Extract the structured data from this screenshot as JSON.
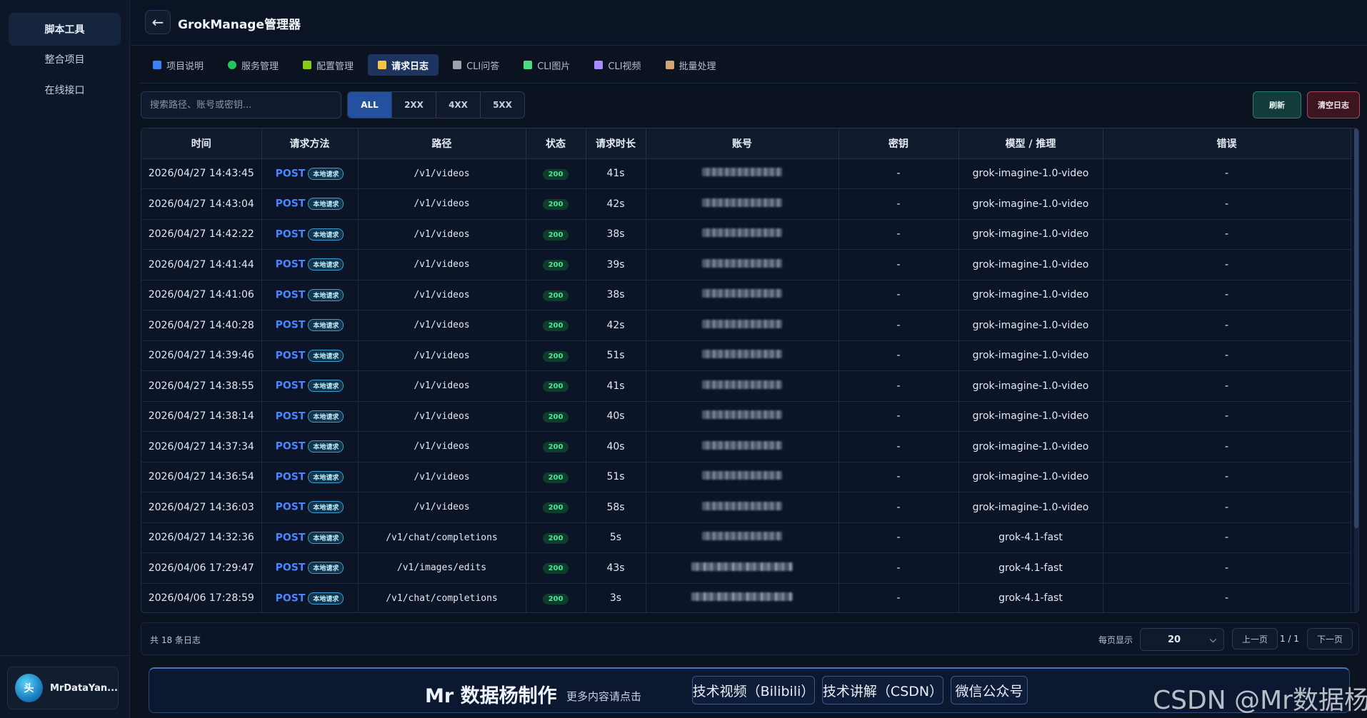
{
  "sidebar": {
    "items": [
      {
        "label": "脚本工具",
        "active": true
      },
      {
        "label": "整合项目",
        "active": false
      },
      {
        "label": "在线接口",
        "active": false
      }
    ],
    "user": {
      "avatar_text": "头",
      "name": "MrDataYan..."
    }
  },
  "header": {
    "back_icon": "arrow-left-icon",
    "back_glyph": "←",
    "title": "GrokManage管理器"
  },
  "tabs": [
    {
      "label": "项目说明",
      "icon": "book-icon",
      "color": "#3b82f6",
      "active": false
    },
    {
      "label": "服务管理",
      "icon": "circle-icon",
      "color": "#22c55e",
      "active": false
    },
    {
      "label": "配置管理",
      "icon": "gear-icon",
      "color": "#84cc16",
      "active": false
    },
    {
      "label": "请求日志",
      "icon": "scroll-icon",
      "color": "#f5c542",
      "active": true
    },
    {
      "label": "CLI问答",
      "icon": "chat-bubble-icon",
      "color": "#9ca3af",
      "active": false
    },
    {
      "label": "CLI图片",
      "icon": "image-icon",
      "color": "#4ade80",
      "active": false
    },
    {
      "label": "CLI视频",
      "icon": "film-icon",
      "color": "#a78bfa",
      "active": false
    },
    {
      "label": "批量处理",
      "icon": "package-icon",
      "color": "#d4a373",
      "active": false
    }
  ],
  "filter": {
    "search_placeholder": "搜索路径、账号或密钥...",
    "status_options": [
      {
        "label": "ALL",
        "active": true
      },
      {
        "label": "2XX",
        "active": false
      },
      {
        "label": "4XX",
        "active": false
      },
      {
        "label": "5XX",
        "active": false
      }
    ],
    "refresh_label": "刷新",
    "clear_label": "清空日志"
  },
  "table": {
    "columns": [
      "时间",
      "请求方法",
      "路径",
      "状态",
      "请求时长",
      "账号",
      "密钥",
      "模型 / 推理",
      "错误"
    ],
    "local_badge": "本地请求",
    "rows": [
      {
        "time": "2026/04/27 14:43:45",
        "method": "POST",
        "path": "/v1/videos",
        "status": "200",
        "duration": "41s",
        "key": "-",
        "model": "grok-imagine-1.0-video",
        "error": "-"
      },
      {
        "time": "2026/04/27 14:43:04",
        "method": "POST",
        "path": "/v1/videos",
        "status": "200",
        "duration": "42s",
        "key": "-",
        "model": "grok-imagine-1.0-video",
        "error": "-"
      },
      {
        "time": "2026/04/27 14:42:22",
        "method": "POST",
        "path": "/v1/videos",
        "status": "200",
        "duration": "38s",
        "key": "-",
        "model": "grok-imagine-1.0-video",
        "error": "-"
      },
      {
        "time": "2026/04/27 14:41:44",
        "method": "POST",
        "path": "/v1/videos",
        "status": "200",
        "duration": "39s",
        "key": "-",
        "model": "grok-imagine-1.0-video",
        "error": "-"
      },
      {
        "time": "2026/04/27 14:41:06",
        "method": "POST",
        "path": "/v1/videos",
        "status": "200",
        "duration": "38s",
        "key": "-",
        "model": "grok-imagine-1.0-video",
        "error": "-"
      },
      {
        "time": "2026/04/27 14:40:28",
        "method": "POST",
        "path": "/v1/videos",
        "status": "200",
        "duration": "42s",
        "key": "-",
        "model": "grok-imagine-1.0-video",
        "error": "-"
      },
      {
        "time": "2026/04/27 14:39:46",
        "method": "POST",
        "path": "/v1/videos",
        "status": "200",
        "duration": "51s",
        "key": "-",
        "model": "grok-imagine-1.0-video",
        "error": "-"
      },
      {
        "time": "2026/04/27 14:38:55",
        "method": "POST",
        "path": "/v1/videos",
        "status": "200",
        "duration": "41s",
        "key": "-",
        "model": "grok-imagine-1.0-video",
        "error": "-"
      },
      {
        "time": "2026/04/27 14:38:14",
        "method": "POST",
        "path": "/v1/videos",
        "status": "200",
        "duration": "40s",
        "key": "-",
        "model": "grok-imagine-1.0-video",
        "error": "-"
      },
      {
        "time": "2026/04/27 14:37:34",
        "method": "POST",
        "path": "/v1/videos",
        "status": "200",
        "duration": "40s",
        "key": "-",
        "model": "grok-imagine-1.0-video",
        "error": "-"
      },
      {
        "time": "2026/04/27 14:36:54",
        "method": "POST",
        "path": "/v1/videos",
        "status": "200",
        "duration": "51s",
        "key": "-",
        "model": "grok-imagine-1.0-video",
        "error": "-"
      },
      {
        "time": "2026/04/27 14:36:03",
        "method": "POST",
        "path": "/v1/videos",
        "status": "200",
        "duration": "58s",
        "key": "-",
        "model": "grok-imagine-1.0-video",
        "error": "-"
      },
      {
        "time": "2026/04/27 14:32:36",
        "method": "POST",
        "path": "/v1/chat/completions",
        "status": "200",
        "duration": "5s",
        "key": "-",
        "model": "grok-4.1-fast",
        "error": "-"
      },
      {
        "time": "2026/04/06 17:29:47",
        "method": "POST",
        "path": "/v1/images/edits",
        "status": "200",
        "duration": "43s",
        "key": "-",
        "model": "grok-4.1-fast",
        "error": "-",
        "wide_account": true
      },
      {
        "time": "2026/04/06 17:28:59",
        "method": "POST",
        "path": "/v1/chat/completions",
        "status": "200",
        "duration": "3s",
        "key": "-",
        "model": "grok-4.1-fast",
        "error": "-",
        "wide_account": true
      }
    ]
  },
  "pager": {
    "total_text": "共 18 条日志",
    "per_page_label": "每页显示",
    "per_page_value": "20",
    "prev_label": "上一页",
    "page_info": "1 / 1",
    "next_label": "下一页"
  },
  "promo": {
    "main_text": "Mr 数据杨制作",
    "sub_text": "更多内容请点击",
    "buttons": [
      "技术视频（Bilibili）",
      "技术讲解（CSDN）",
      "微信公众号"
    ]
  },
  "watermark": "CSDN @Mr数据杨"
}
